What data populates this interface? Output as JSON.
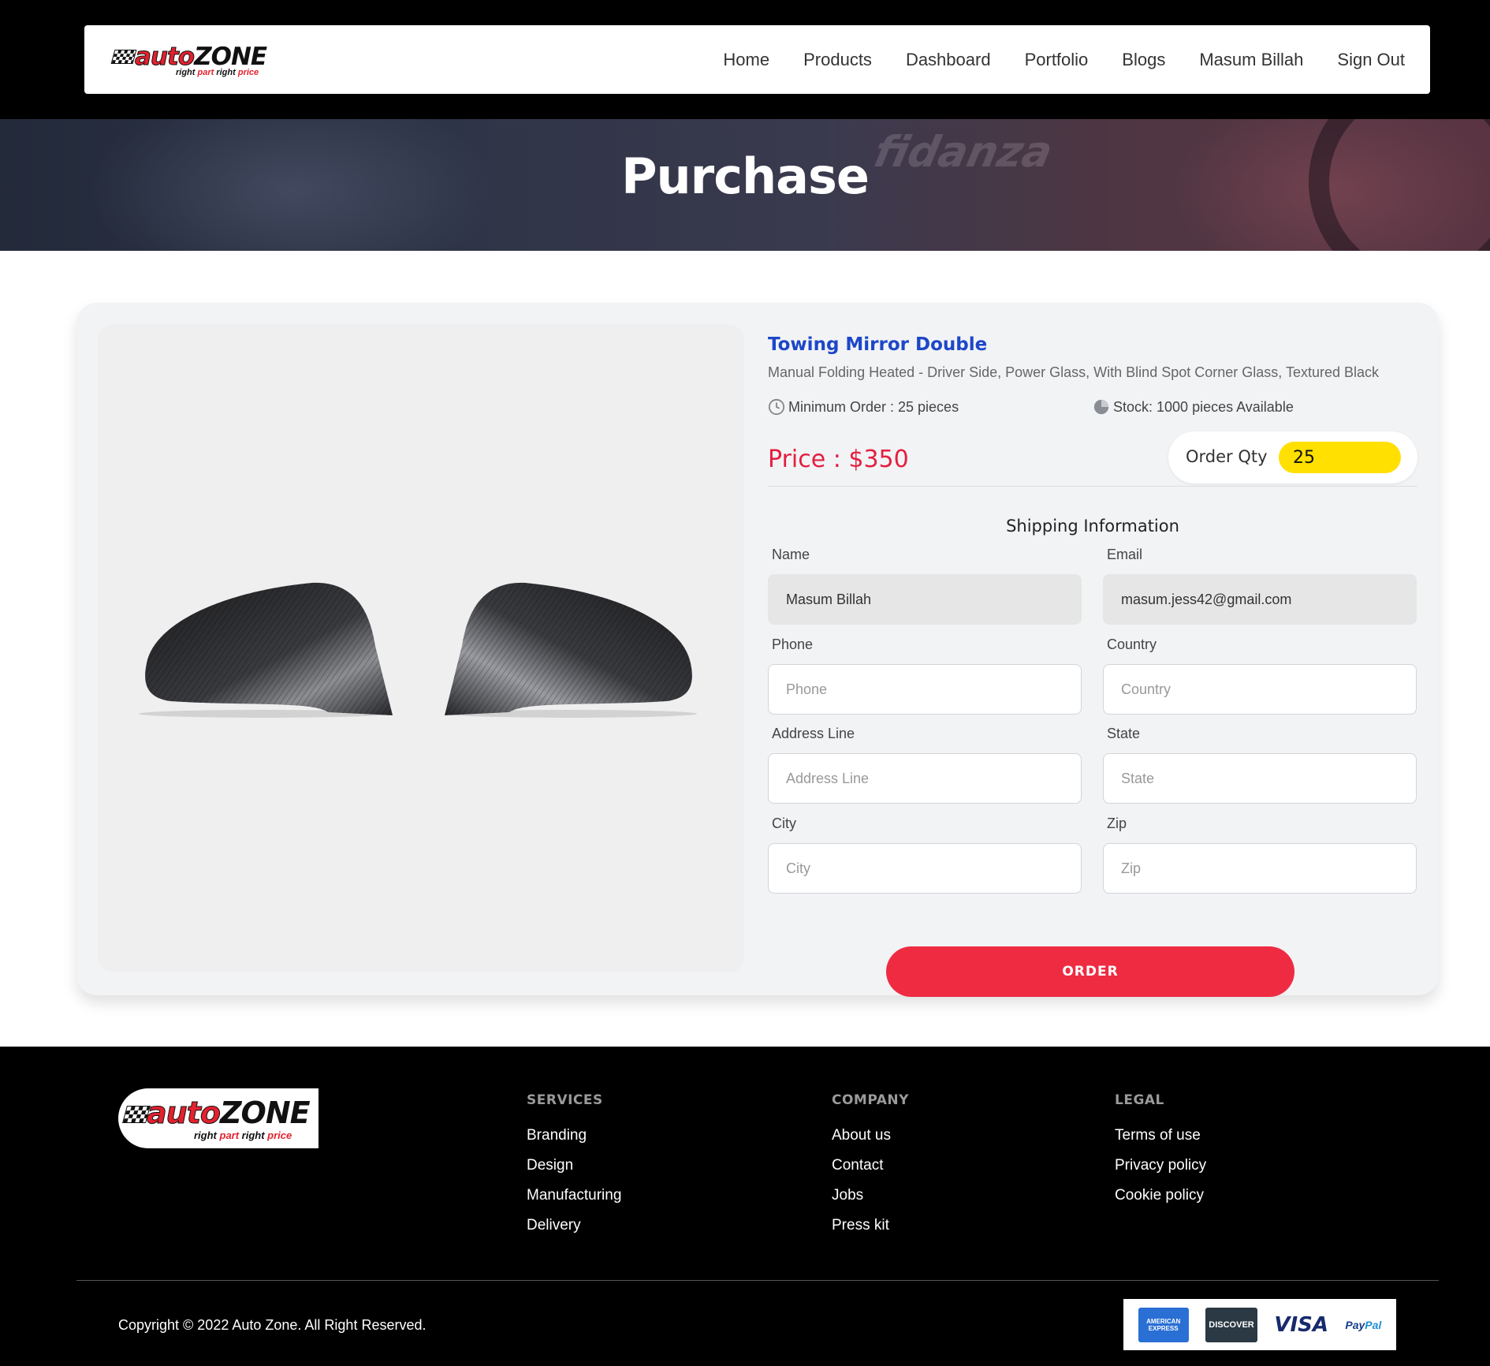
{
  "brand": {
    "logo_main_1": "auto",
    "logo_main_2": "ZONE",
    "tagline_1": "right ",
    "tagline_2": "part",
    "tagline_3": " right ",
    "tagline_4": "price"
  },
  "nav": {
    "items": [
      "Home",
      "Products",
      "Dashboard",
      "Portfolio",
      "Blogs",
      "Masum Billah",
      "Sign Out"
    ]
  },
  "hero": {
    "title": "Purchase",
    "bg_brand_text": "fidanza"
  },
  "product": {
    "title": "Towing Mirror Double",
    "description": "Manual Folding Heated - Driver Side, Power Glass, With Blind Spot Corner Glass, Textured Black",
    "minimum_order": "Minimum Order : 25 pieces",
    "stock": "Stock: 1000 pieces Available",
    "price": "Price : $350",
    "order_qty_label": "Order Qty",
    "order_qty_value": "25",
    "image_alt": "Carbon fiber mirror covers"
  },
  "shipping": {
    "title": "Shipping Information",
    "fields": {
      "name": {
        "label": "Name",
        "value": "Masum Billah",
        "placeholder": ""
      },
      "email": {
        "label": "Email",
        "value": "masum.jess42@gmail.com",
        "placeholder": ""
      },
      "phone": {
        "label": "Phone",
        "value": "",
        "placeholder": "Phone"
      },
      "country": {
        "label": "Country",
        "value": "",
        "placeholder": "Country"
      },
      "address": {
        "label": "Address Line",
        "value": "",
        "placeholder": "Address Line"
      },
      "state": {
        "label": "State",
        "value": "",
        "placeholder": "State"
      },
      "city": {
        "label": "City",
        "value": "",
        "placeholder": "City"
      },
      "zip": {
        "label": "Zip",
        "value": "",
        "placeholder": "Zip"
      }
    },
    "order_button": "ORDER"
  },
  "footer": {
    "services": {
      "heading": "SERVICES",
      "links": [
        "Branding",
        "Design",
        "Manufacturing",
        "Delivery"
      ]
    },
    "company": {
      "heading": "COMPANY",
      "links": [
        "About us",
        "Contact",
        "Jobs",
        "Press kit"
      ]
    },
    "legal": {
      "heading": "LEGAL",
      "links": [
        "Terms of use",
        "Privacy policy",
        "Cookie policy"
      ]
    },
    "copyright": "Copyright © 2022 Auto Zone. All Right Reserved.",
    "payments": {
      "amex": "AMERICAN EXPRESS",
      "discover": "DISCOVER",
      "visa": "VISA",
      "paypal_1": "Pay",
      "paypal_2": "Pal"
    }
  },
  "colors": {
    "accent_blue": "#1d47c9",
    "price_red": "#e41e3f",
    "order_button": "#ef2b42",
    "qty_yellow": "#ffe000"
  },
  "icons": {
    "minimum_order": "clock-icon",
    "stock": "pie-chart-icon"
  }
}
